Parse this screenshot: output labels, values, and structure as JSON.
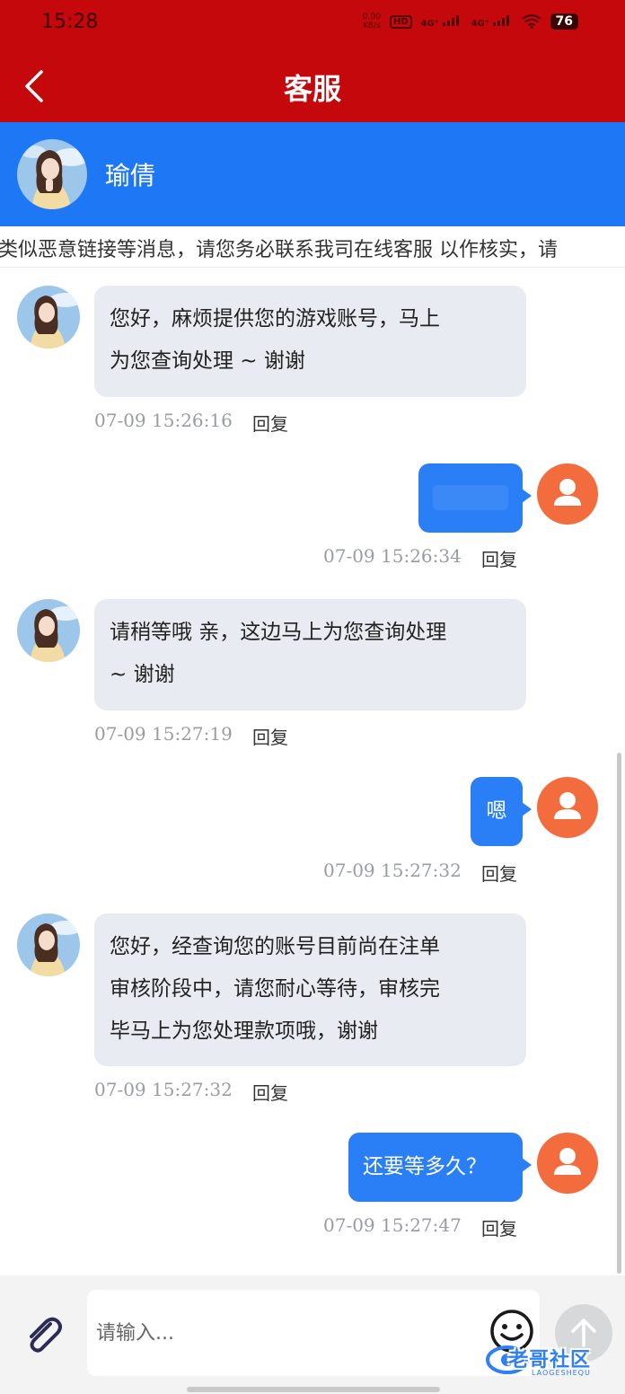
{
  "status_bar": {
    "time": "15:28",
    "net_speed_value": "0.00",
    "net_speed_unit": "KB/s",
    "hd_label": "HD",
    "signal_1": "4G⁺",
    "signal_2": "4G⁺",
    "battery": "76"
  },
  "nav": {
    "title": "客服",
    "back_icon": "chevron-left-icon"
  },
  "agent": {
    "name": "瑜倩"
  },
  "marquee": {
    "text": "类似恶意链接等消息，请您务必联系我司在线客服 以作核实，请"
  },
  "messages": [
    {
      "side": "in",
      "lines": [
        "您好，麻烦提供您的游戏账号，马上",
        "为您查询处理 ~ 谢谢"
      ],
      "time": "07-09 15:26:16",
      "reply": "回复"
    },
    {
      "side": "out",
      "text": "",
      "time": "07-09 15:26:34",
      "reply": "回复"
    },
    {
      "side": "in",
      "lines": [
        "请稍等哦 亲，这边马上为您查询处理",
        "~ 谢谢"
      ],
      "time": "07-09 15:27:19",
      "reply": "回复"
    },
    {
      "side": "out",
      "text": "嗯",
      "time": "07-09 15:27:32",
      "reply": "回复"
    },
    {
      "side": "in",
      "lines": [
        "您好，经查询您的账号目前尚在注单",
        "审核阶段中，请您耐心等待，审核完",
        "毕马上为您处理款项哦，谢谢"
      ],
      "time": "07-09 15:27:32",
      "reply": "回复"
    },
    {
      "side": "out",
      "text": "还要等多久？",
      "time": "07-09 15:27:47",
      "reply": "回复"
    }
  ],
  "input": {
    "placeholder": "请输入..."
  },
  "watermark": {
    "text": "老哥社区",
    "sub": "LAOGESHEQU"
  },
  "colors": {
    "nav_red": "#c4080c",
    "header_blue": "#1e78f5",
    "bubble_out_blue": "#2b7ff6",
    "bubble_in_gray": "#e8ebf2",
    "user_avatar_orange": "#f26c3e"
  }
}
